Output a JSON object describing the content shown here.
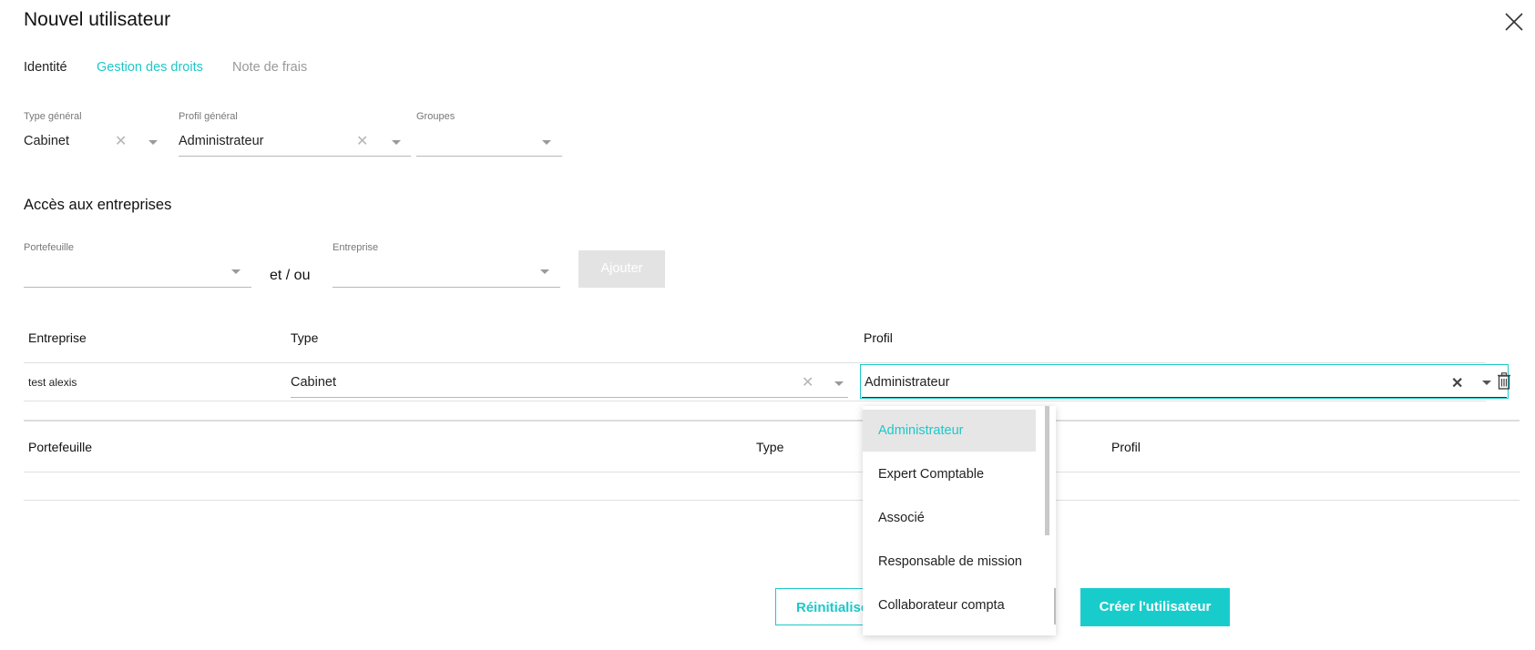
{
  "window": {
    "title": "Nouvel utilisateur"
  },
  "tabs": [
    {
      "label": "Identité"
    },
    {
      "label": "Gestion des droits"
    },
    {
      "label": "Note de frais"
    }
  ],
  "general": {
    "type_label": "Type général",
    "type_value": "Cabinet",
    "profil_label": "Profil général",
    "profil_value": "Administrateur",
    "groupes_label": "Groupes",
    "groupes_value": ""
  },
  "access": {
    "heading": "Accès aux entreprises",
    "portefeuille_label": "Portefeuille",
    "separator": "et / ou",
    "entreprise_label": "Entreprise",
    "add_button": "Ajouter"
  },
  "company_table": {
    "headers": [
      "Entreprise",
      "Type",
      "Profil"
    ],
    "rows": [
      {
        "entreprise": "test alexis",
        "type": "Cabinet",
        "profil": "Administrateur"
      }
    ]
  },
  "portfolio_table": {
    "headers": [
      "Portefeuille",
      "Type",
      "Profil"
    ]
  },
  "profil_dropdown": {
    "options": [
      "Administrateur",
      "Expert Comptable",
      "Associé",
      "Responsable de mission",
      "Collaborateur compta"
    ],
    "selected": "Administrateur"
  },
  "footer": {
    "reset_button": "Réinitialiser",
    "create_button": "Créer l'utilisateur"
  },
  "colors": {
    "accent": "#1ec8c8",
    "muted": "#9a9a9a"
  }
}
